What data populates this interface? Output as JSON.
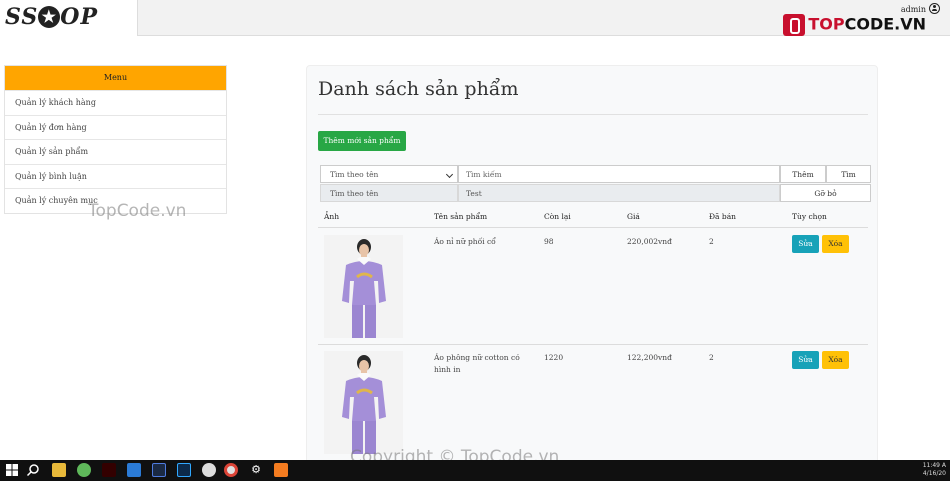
{
  "header": {
    "logo_text": "SSHOP",
    "user_name": "admin",
    "watermark_brand_a": "TOP",
    "watermark_brand_b": "CODE.VN"
  },
  "sidebar": {
    "title": "Menu",
    "items": [
      {
        "label": "Quản lý khách hàng"
      },
      {
        "label": "Quản lý đơn hàng"
      },
      {
        "label": "Quản lý sản phẩm"
      },
      {
        "label": "Quản lý bình luận"
      },
      {
        "label": "Quản lý chuyên mục"
      }
    ]
  },
  "main": {
    "title": "Danh sách sản phẩm",
    "add_button": "Thêm mới sản phẩm",
    "filter": {
      "select_value": "Tìm theo tên",
      "search_placeholder": "Tìm kiếm",
      "add_label": "Thêm",
      "search_label": "Tìm",
      "active_filter_label": "Tìm theo tên",
      "active_filter_value": "Test",
      "clear_label": "Gỡ bỏ"
    },
    "table": {
      "headers": [
        "Ảnh",
        "Tên sản phẩm",
        "Còn lại",
        "Giá",
        "Đã bán",
        "Tùy chọn"
      ],
      "rows": [
        {
          "name": "Áo nỉ nữ phối cổ",
          "stock": "98",
          "price": "220,002vnđ",
          "sold": "2",
          "edit": "Sửa",
          "delete": "Xóa"
        },
        {
          "name": "Áo phông nữ cotton có hình in",
          "stock": "1220",
          "price": "122,200vnđ",
          "sold": "2",
          "edit": "Sửa",
          "delete": "Xóa"
        }
      ]
    }
  },
  "watermarks": {
    "mid": "TopCode.vn",
    "bottom": "Copyright © TopCode.vn"
  },
  "taskbar": {
    "time": "11:49 A",
    "date": "4/16/20"
  },
  "colors": {
    "menu_header": "#ffa500",
    "add_button": "#28a745",
    "edit_button": "#17a2b8",
    "delete_button": "#ffc107"
  }
}
